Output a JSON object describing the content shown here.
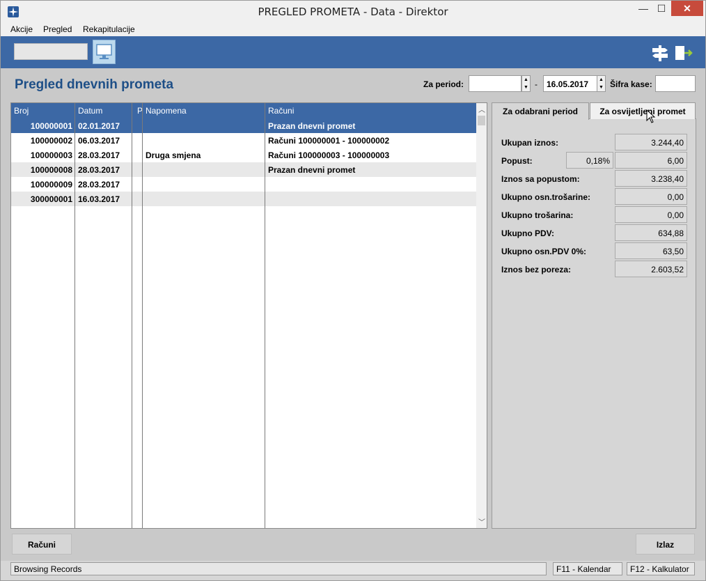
{
  "window": {
    "title": "PREGLED PROMETA - Data - Direktor",
    "minimize": "—",
    "maximize": "☐",
    "close": "✕"
  },
  "menu": [
    "Akcije",
    "Pregled",
    "Rekapitulacije"
  ],
  "page_title": "Pregled dnevnih prometa",
  "filters": {
    "period_label": "Za period:",
    "period_from": "",
    "dash": "-",
    "period_to": "16.05.2017",
    "sifra_label": "Šifra kase:",
    "sifra_value": ""
  },
  "grid": {
    "columns": [
      "Broj",
      "Datum",
      "P",
      "Napomena",
      "Računi"
    ],
    "rows": [
      [
        "100000001",
        "02.01.2017",
        "",
        "",
        "Prazan dnevni promet"
      ],
      [
        "100000002",
        "06.03.2017",
        "",
        "",
        "Računi 100000001 - 100000002"
      ],
      [
        "100000003",
        "28.03.2017",
        "",
        "Druga smjena",
        "Računi 100000003 - 100000003"
      ],
      [
        "100000008",
        "28.03.2017",
        "",
        "",
        "Prazan dnevni promet"
      ],
      [
        "100000009",
        "28.03.2017",
        "",
        "",
        ""
      ],
      [
        "300000001",
        "16.03.2017",
        "",
        "",
        ""
      ]
    ]
  },
  "tabs": {
    "active": "Za odabrani period",
    "inactive": "Za osvijetljeni promet"
  },
  "summary": {
    "ukupan_iznos": {
      "label": "Ukupan iznos:",
      "value": "3.244,40"
    },
    "popust": {
      "label": "Popust:",
      "percent": "0,18%",
      "value": "6,00"
    },
    "iznos_sa_popustom": {
      "label": "Iznos sa popustom:",
      "value": "3.238,40"
    },
    "osn_trosarine": {
      "label": "Ukupno osn.trošarine:",
      "value": "0,00"
    },
    "trosarina": {
      "label": "Ukupno trošarina:",
      "value": "0,00"
    },
    "pdv": {
      "label": "Ukupno PDV:",
      "value": "634,88"
    },
    "osn_pdv0": {
      "label": "Ukupno osn.PDV 0%:",
      "value": "63,50"
    },
    "bez_poreza": {
      "label": "Iznos bez poreza:",
      "value": "2.603,52"
    }
  },
  "buttons": {
    "racuni": "Računi",
    "izlaz": "Izlaz"
  },
  "status": {
    "mode": "Browsing Records",
    "f11": "F11 - Kalendar",
    "f12": "F12 - Kalkulator"
  },
  "colors": {
    "accent": "#3c68a5",
    "title": "#1e4f87",
    "close": "#c74b3c"
  },
  "icons": [
    "app-icon",
    "monitor-icon",
    "signpost-icon",
    "exit-icon",
    "spin-up-icon",
    "spin-down-icon",
    "scroll-up-icon",
    "scroll-down-icon",
    "mouse-cursor-icon"
  ]
}
